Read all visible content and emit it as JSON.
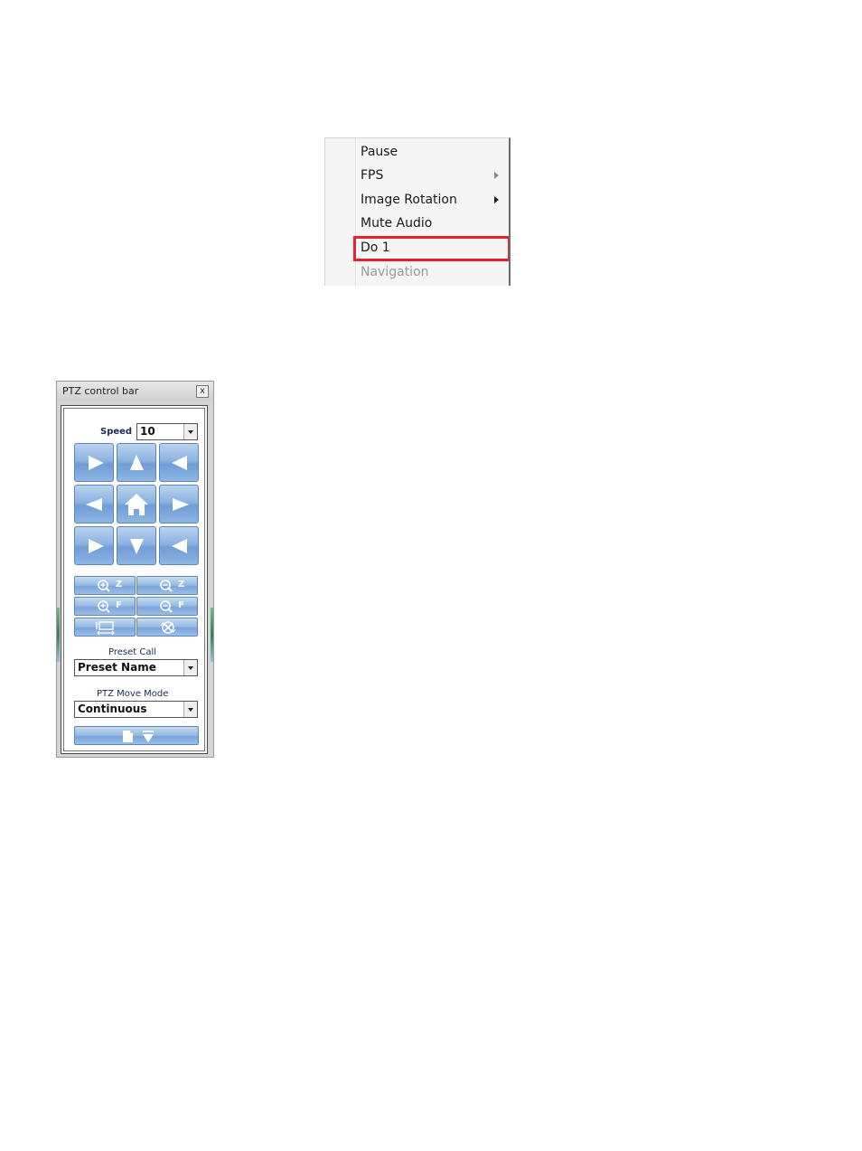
{
  "context_menu": {
    "items": [
      {
        "label": "Pause",
        "submenu": false,
        "enabled": true
      },
      {
        "label": "FPS",
        "submenu": true,
        "enabled": true
      },
      {
        "label": "Image Rotation",
        "submenu": true,
        "enabled": true
      },
      {
        "label": "Mute Audio",
        "submenu": false,
        "enabled": true
      },
      {
        "label": "Do 1",
        "submenu": false,
        "enabled": true,
        "highlighted": true
      },
      {
        "label": "Navigation",
        "submenu": false,
        "enabled": false
      }
    ],
    "highlight_color": "#e8202f"
  },
  "ptz": {
    "title": "PTZ control  bar",
    "close_label": "x",
    "speed_label": "Speed",
    "speed_value": "10",
    "zoom_letter": "Z",
    "focus_letter": "F",
    "preset_label": "Preset Call",
    "preset_value": "Preset Name",
    "move_mode_label": "PTZ Move Mode",
    "move_mode_value": "Continuous",
    "button_color": "#8db3e1"
  }
}
